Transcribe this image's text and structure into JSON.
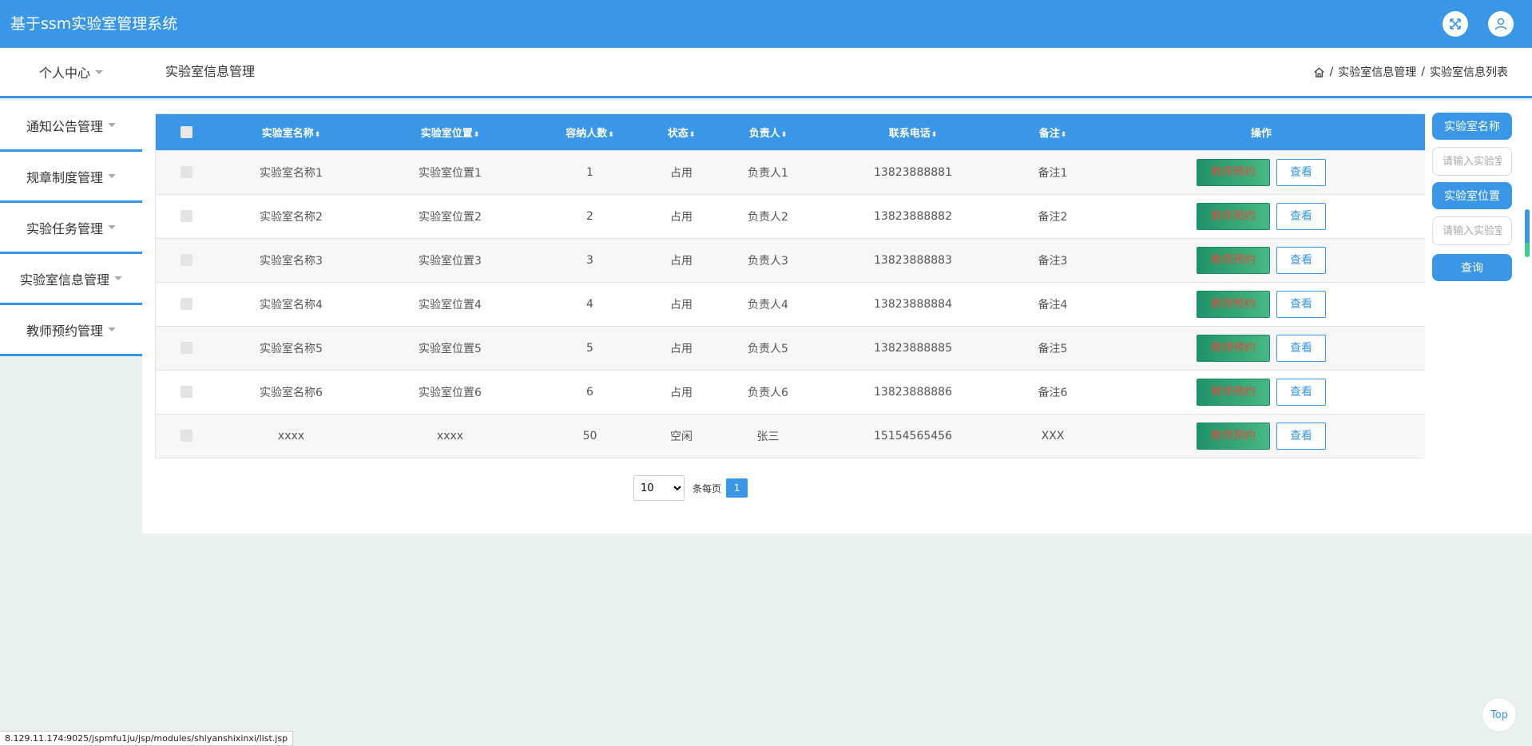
{
  "app": {
    "title": "基于ssm实验室管理系统"
  },
  "header": {
    "personal_center": "个人中心",
    "page_heading": "实验室信息管理",
    "breadcrumb": [
      "实验室信息管理",
      "实验室信息列表"
    ]
  },
  "sidebar": {
    "items": [
      {
        "label": "通知公告管理"
      },
      {
        "label": "规章制度管理"
      },
      {
        "label": "实验任务管理"
      },
      {
        "label": "实验室信息管理"
      },
      {
        "label": "教师预约管理"
      }
    ]
  },
  "table": {
    "columns": [
      "实验室名称",
      "实验室位置",
      "容纳人数",
      "状态",
      "负责人",
      "联系电话",
      "备注",
      "操作"
    ],
    "rows": [
      {
        "name": "实验室名称1",
        "location": "实验室位置1",
        "capacity": "1",
        "status": "占用",
        "manager": "负责人1",
        "phone": "13823888881",
        "remark": "备注1"
      },
      {
        "name": "实验室名称2",
        "location": "实验室位置2",
        "capacity": "2",
        "status": "占用",
        "manager": "负责人2",
        "phone": "13823888882",
        "remark": "备注2"
      },
      {
        "name": "实验室名称3",
        "location": "实验室位置3",
        "capacity": "3",
        "status": "占用",
        "manager": "负责人3",
        "phone": "13823888883",
        "remark": "备注3"
      },
      {
        "name": "实验室名称4",
        "location": "实验室位置4",
        "capacity": "4",
        "status": "占用",
        "manager": "负责人4",
        "phone": "13823888884",
        "remark": "备注4"
      },
      {
        "name": "实验室名称5",
        "location": "实验室位置5",
        "capacity": "5",
        "status": "占用",
        "manager": "负责人5",
        "phone": "13823888885",
        "remark": "备注5"
      },
      {
        "name": "实验室名称6",
        "location": "实验室位置6",
        "capacity": "6",
        "status": "占用",
        "manager": "负责人6",
        "phone": "13823888886",
        "remark": "备注6"
      },
      {
        "name": "xxxx",
        "location": "xxxx",
        "capacity": "50",
        "status": "空闲",
        "manager": "张三",
        "phone": "15154565456",
        "remark": "XXX"
      }
    ],
    "reserve_label": "教师预约",
    "view_label": "查看"
  },
  "pagination": {
    "page_size": "10",
    "per_page_label": "条每页",
    "current_page": "1"
  },
  "search": {
    "name_label": "实验室名称",
    "name_placeholder": "请输入实验室名称",
    "location_label": "实验室位置",
    "location_placeholder": "请输入实验室位置",
    "query_label": "查询"
  },
  "top_button": "Top",
  "status_url": "8.129.11.174:9025/jspmfu1ju/jsp/modules/shiyanshixinxi/list.jsp",
  "colors": {
    "primary": "#3a96e6",
    "reserve_bg": "#2a9d73",
    "reserve_text": "#e04a3c",
    "page_bg": "#e8f3ef"
  }
}
